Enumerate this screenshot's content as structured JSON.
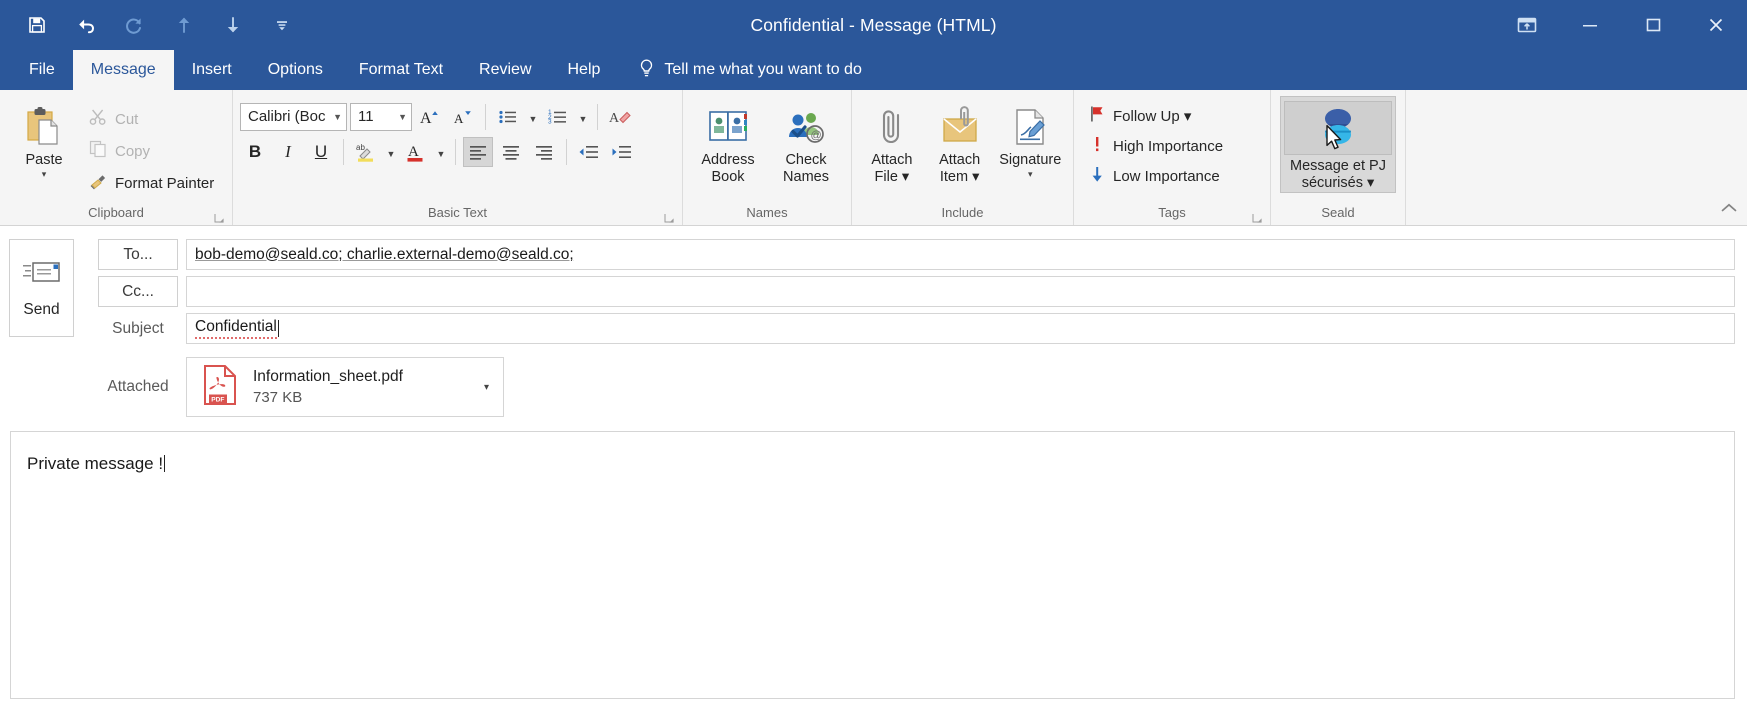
{
  "window": {
    "title": "Confidential  -  Message (HTML)",
    "quick_access": [
      {
        "name": "save-icon",
        "label": "Save"
      },
      {
        "name": "undo-icon",
        "label": "Undo"
      },
      {
        "name": "redo-icon",
        "label": "Redo"
      },
      {
        "name": "previous-item-icon",
        "label": "Previous Item"
      },
      {
        "name": "next-item-icon",
        "label": "Next Item"
      },
      {
        "name": "customize-quick-access-toolbar-icon",
        "label": "Customize Quick Access Toolbar"
      }
    ],
    "controls": [
      {
        "name": "ribbon-display-options-button",
        "label": "Ribbon Display Options"
      },
      {
        "name": "minimize-button",
        "label": "Minimize"
      },
      {
        "name": "maximize-button",
        "label": "Maximize"
      },
      {
        "name": "close-button",
        "label": "Close"
      }
    ],
    "accent_color": "#2b579a"
  },
  "tabs": [
    {
      "label": "File",
      "active": false
    },
    {
      "label": "Message",
      "active": true
    },
    {
      "label": "Insert",
      "active": false
    },
    {
      "label": "Options",
      "active": false
    },
    {
      "label": "Format Text",
      "active": false
    },
    {
      "label": "Review",
      "active": false
    },
    {
      "label": "Help",
      "active": false
    }
  ],
  "tell_me": {
    "label": "Tell me what you want to do",
    "icon": "lightbulb-icon"
  },
  "ribbon": {
    "groups": [
      {
        "label": "Clipboard"
      },
      {
        "label": "Basic Text"
      },
      {
        "label": "Names"
      },
      {
        "label": "Include"
      },
      {
        "label": "Tags"
      },
      {
        "label": "Seald"
      }
    ],
    "clipboard": {
      "paste": {
        "label": "Paste",
        "caret": "▾"
      },
      "cut": {
        "label": "Cut",
        "disabled": true
      },
      "copy": {
        "label": "Copy",
        "disabled": true
      },
      "format_painter": {
        "label": "Format Painter",
        "disabled": false
      }
    },
    "basic_text": {
      "font_name": "Calibri (Boc",
      "font_size": "11",
      "grow_font": "A",
      "shrink_font": "A",
      "bold": "B",
      "italic": "I",
      "underline": "U",
      "align_left_active": true
    },
    "names": {
      "address_book": "Address\nBook",
      "check_names": "Check\nNames"
    },
    "include": {
      "attach_file": "Attach\nFile ▾",
      "attach_item": "Attach\nItem ▾",
      "signature": "Signature"
    },
    "tags": {
      "follow_up": "Follow Up ▾",
      "high_importance": "High Importance",
      "low_importance": "Low Importance"
    },
    "seald": {
      "button_label": "Message et PJ\nsécurisés ▾",
      "hovered": true,
      "icon": "seald-logo-icon",
      "cursor_present": true
    },
    "collapse_label": "Collapse the Ribbon"
  },
  "compose": {
    "send_button": {
      "label": "Send"
    },
    "to": {
      "button_label": "To...",
      "value": "bob-demo@seald.co; charlie.external-demo@seald.co;"
    },
    "cc": {
      "button_label": "Cc...",
      "value": ""
    },
    "subject": {
      "label": "Subject",
      "value": "Confidential",
      "misspelled": true
    },
    "attached": {
      "label": "Attached",
      "file_name": "Information_sheet.pdf",
      "file_size": "737 KB",
      "file_type_icon": "pdf-file-icon",
      "file_type_text": "PDF",
      "caret": "▾"
    },
    "body": {
      "text": "Private message !",
      "has_caret": true
    }
  }
}
